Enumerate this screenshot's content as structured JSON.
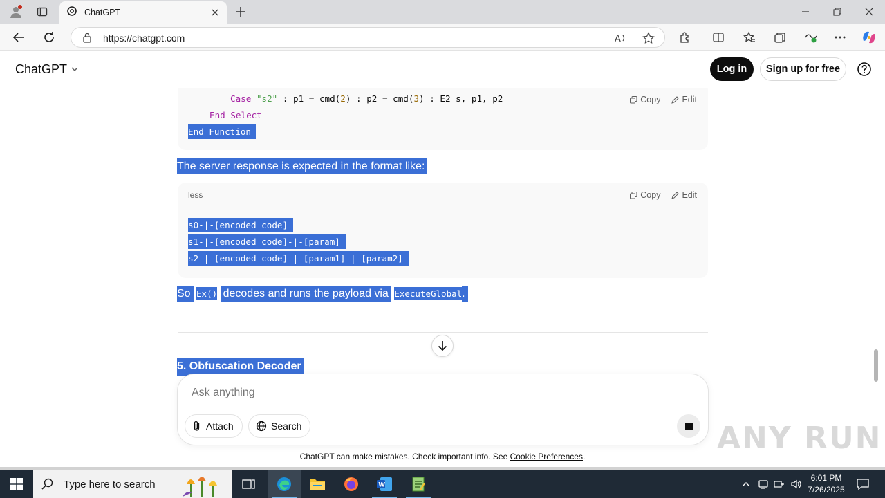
{
  "browser": {
    "tab_title": "ChatGPT",
    "url": "https://chatgpt.com"
  },
  "header": {
    "brand": "ChatGPT",
    "login_label": "Log in",
    "signup_label": "Sign up for free"
  },
  "code_block_1": {
    "line1": {
      "kw": "Case",
      "str": "\"s2\"",
      "a": " : p1 = cmd(",
      "n1": "2",
      "b": ") : p2 = cmd(",
      "n2": "3",
      "c": ") : E2 s, p1, p2"
    },
    "line2": "End Select",
    "line3": "End Function",
    "copy_label": "Copy",
    "edit_label": "Edit"
  },
  "paragraph_1": "The server response is expected in the format like:",
  "code_block_2": {
    "language": "less",
    "lines": [
      "s0-|-[encoded code]",
      "s1-|-[encoded code]-|-[param]",
      "s2-|-[encoded code]-|-[param1]-|-[param2]"
    ],
    "copy_label": "Copy",
    "edit_label": "Edit"
  },
  "paragraph_2": {
    "t1": "So",
    "code1": "Ex()",
    "t2": "decodes and runs the payload via",
    "code2": "ExecuteGlobal",
    "t3": "."
  },
  "section_heading": "5. Obfuscation Decoder",
  "composer": {
    "placeholder": "Ask anything",
    "attach_label": "Attach",
    "search_label": "Search"
  },
  "disclaimer": {
    "text": "ChatGPT can make mistakes. Check important info. See ",
    "link": "Cookie Preferences",
    "end": "."
  },
  "watermark": "ANY RUN",
  "taskbar": {
    "search_placeholder": "Type here to search",
    "time": "6:01 PM",
    "date": "7/26/2025"
  },
  "colors": {
    "selection": "#3b6fd6",
    "taskbar": "#1f2a36",
    "button_dark": "#0d0d0d"
  }
}
